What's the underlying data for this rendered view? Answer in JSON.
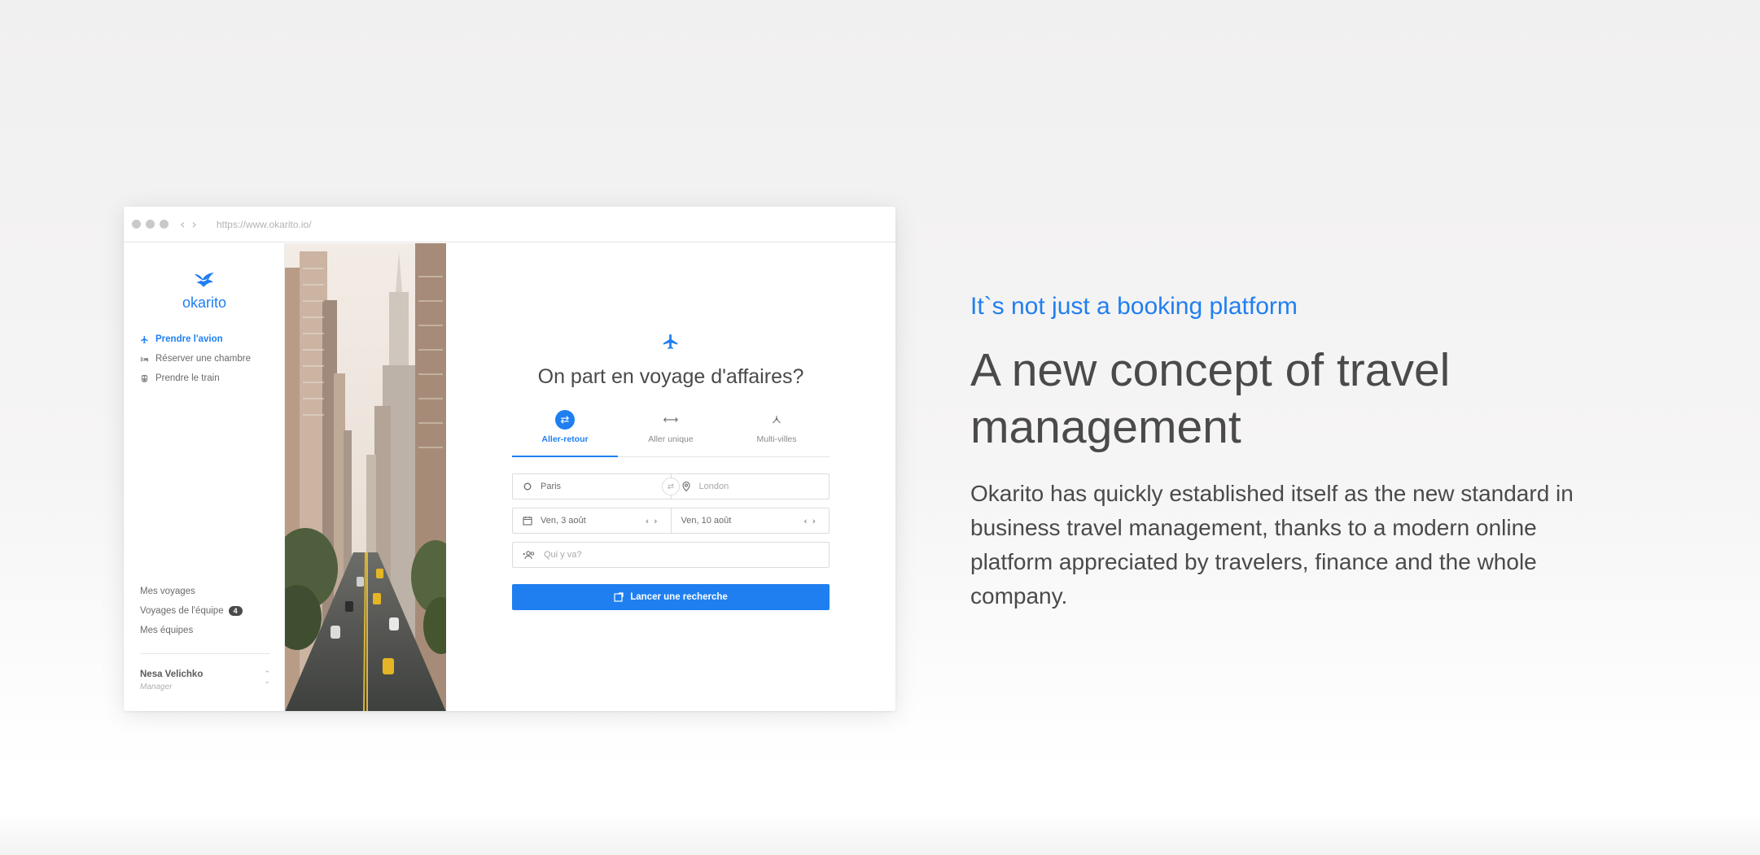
{
  "browser": {
    "url": "https://www.okarito.io/"
  },
  "app": {
    "logo_text": "okarito",
    "nav": [
      {
        "label": "Prendre l'avion",
        "icon": "plane-icon",
        "active": true
      },
      {
        "label": "Réserver une chambre",
        "icon": "bed-icon",
        "active": false
      },
      {
        "label": "Prendre le train",
        "icon": "train-icon",
        "active": false
      }
    ],
    "bottom_nav": {
      "my_trips": "Mes voyages",
      "team_trips": "Voyages de l'équipe",
      "team_trips_count": "4",
      "my_teams": "Mes équipes"
    },
    "user": {
      "name": "Nesa Velichko",
      "role": "Manager"
    }
  },
  "search": {
    "title": "On part en voyage d'affaires?",
    "tabs": [
      {
        "label": "Aller-retour",
        "icon": "swap-icon",
        "active": true
      },
      {
        "label": "Aller unique",
        "icon": "one-way-icon",
        "active": false
      },
      {
        "label": "Multi-villes",
        "icon": "multi-city-icon",
        "active": false
      }
    ],
    "origin": "Paris",
    "destination_placeholder": "London",
    "depart_date": "Ven, 3 août",
    "return_date": "Ven, 10 août",
    "travelers_placeholder": "Qui y va?",
    "submit_label": "Lancer une recherche"
  },
  "marketing": {
    "eyebrow": "It`s not just a booking platform",
    "headline": "A new concept of travel management",
    "body": "Okarito has quickly established itself as the new standard in business travel management, thanks to a modern online platform appreciated by travelers, finance and the whole company."
  },
  "colors": {
    "accent": "#1f7ff0",
    "text": "#4a4a4a"
  }
}
